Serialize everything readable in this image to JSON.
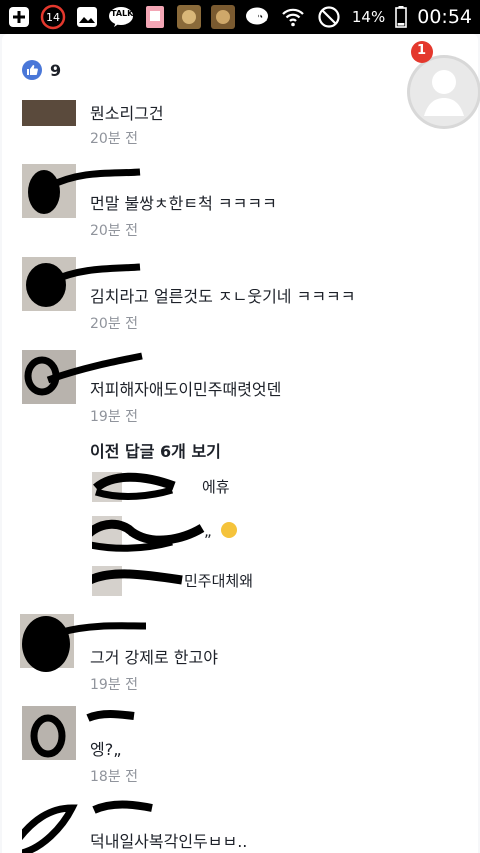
{
  "status_bar": {
    "badge": "14",
    "talk_label": "TALK",
    "battery": "14%",
    "time": "00:54"
  },
  "reactions": {
    "like_count": "9"
  },
  "chathead": {
    "badge": "1"
  },
  "comments": [
    {
      "text": "뭔소리그건",
      "time": "20분 전"
    },
    {
      "text": "먼말 불쌍ㅊ한ㅌ척 ㅋㅋㅋㅋ",
      "time": "20분 전"
    },
    {
      "text": "김치라고 얼른것도 ㅈㄴ웃기네 ㅋㅋㅋㅋ",
      "time": "20분 전"
    },
    {
      "text": "저피해자애도이민주때렷엇덴",
      "time": "19분 전"
    },
    {
      "text": "그거 강제로 한고야",
      "time": "19분 전"
    },
    {
      "text": "엥?„",
      "time": "18분 전"
    },
    {
      "text": "덕내일사복각인두ㅂㅂ..",
      "time": ""
    }
  ],
  "more_replies_label": "이전 답글 6개 보기",
  "replies": [
    {
      "text": "에휴"
    },
    {
      "text": "„"
    },
    {
      "text": "민주대체왜"
    }
  ],
  "colors": {
    "like_blue": "#4a77d8",
    "badge_red": "#e4382d",
    "time_gray": "#90949c"
  }
}
